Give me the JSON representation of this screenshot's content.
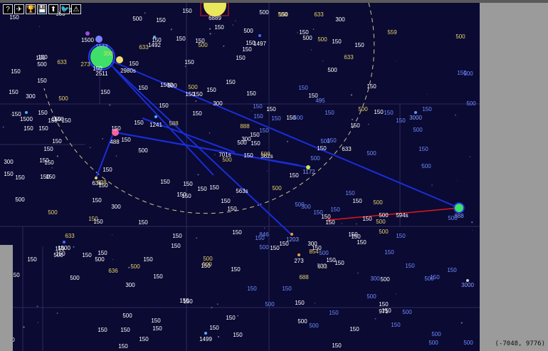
{
  "toolbar": {
    "buttons": [
      {
        "glyph": "?",
        "icon": "help-icon"
      },
      {
        "glyph": "✈",
        "icon": "send-icon"
      },
      {
        "glyph": "🏆",
        "icon": "trophy-icon"
      },
      {
        "glyph": "💾",
        "icon": "save-icon"
      },
      {
        "glyph": "⬆",
        "icon": "upload-icon"
      },
      {
        "glyph": "🐦",
        "icon": "twitter-icon"
      },
      {
        "glyph": "⚠",
        "icon": "warning-icon"
      }
    ]
  },
  "coords": "(-7048, 9776)",
  "colors": {
    "space": "#0b0a33",
    "own": "#ffffff",
    "enemy": "#5a8aff",
    "neutral": "#e8d468",
    "link": "#1a2dd8",
    "attack": "#e01818"
  },
  "planets": [
    {
      "id": "p1",
      "label": "6889",
      "color": "#e8e85a",
      "r": 16,
      "owner": "own"
    },
    {
      "id": "p2",
      "label": "2511",
      "color": "#3ee06a",
      "r": 16,
      "owner": "own"
    },
    {
      "id": "p3",
      "label": "1143",
      "color": "#8080ff",
      "r": 5,
      "owner": "own"
    },
    {
      "id": "p4",
      "label": "1500",
      "color": "#9b4dd8",
      "r": 3,
      "owner": "own"
    },
    {
      "id": "p5",
      "label": "1492",
      "color": "#4fb0ff",
      "r": 2,
      "owner": "own"
    },
    {
      "id": "p6",
      "label": "1497",
      "color": "#4a6cff",
      "r": 2,
      "owner": "own"
    },
    {
      "id": "p7",
      "label": "1500",
      "color": "#4fb0ff",
      "r": 2,
      "owner": "own"
    },
    {
      "id": "p8",
      "label": "1241",
      "color": "#4fb0ff",
      "r": 2,
      "owner": "own"
    },
    {
      "id": "p9",
      "label": "488",
      "color": "#ff5f9f",
      "r": 5,
      "owner": "own"
    },
    {
      "id": "p10",
      "label": "636",
      "color": "#e8d468",
      "r": 2,
      "owner": "own"
    },
    {
      "id": "p11",
      "label": "1172",
      "color": "#c6e65a",
      "r": 3,
      "owner": "own"
    },
    {
      "id": "p12",
      "label": "888",
      "color": "#3ee06a",
      "r": 6,
      "owner": "own"
    },
    {
      "id": "p13",
      "label": "1203",
      "color": "#e8a040",
      "r": 2,
      "owner": "own"
    },
    {
      "id": "p14",
      "label": "273",
      "color": "#e8a040",
      "r": 2,
      "owner": "own"
    },
    {
      "id": "p15",
      "label": "1500",
      "color": "#4a6cff",
      "r": 2,
      "owner": "own"
    },
    {
      "id": "p16",
      "label": "1499",
      "color": "#4fb0ff",
      "r": 2,
      "owner": "own"
    },
    {
      "id": "p17",
      "label": "3000",
      "color": "#5a9aff",
      "r": 2,
      "owner": "enemy"
    },
    {
      "id": "p18",
      "label": "3000",
      "color": "#cfcfcf",
      "r": 2,
      "owner": "enemy"
    },
    {
      "id": "p19",
      "label": "971",
      "color": "#cfcfcf",
      "r": 1,
      "owner": "own"
    },
    {
      "id": "p20",
      "label": "150",
      "color": "#e01818",
      "r": 2,
      "owner": "own"
    }
  ],
  "transfers": [
    {
      "id": "v1",
      "label": "2980s"
    },
    {
      "id": "v2",
      "label": "701s"
    },
    {
      "id": "v3",
      "label": "362s"
    },
    {
      "id": "v4",
      "label": "563s"
    },
    {
      "id": "v5",
      "label": "594s"
    }
  ],
  "labels_white": [
    "500",
    "500",
    "500",
    "500",
    "500",
    "150",
    "500",
    "150",
    "150",
    "500",
    "150",
    "150",
    "150",
    "1500",
    "150",
    "500",
    "300",
    "300",
    "150",
    "150",
    "150",
    "150",
    "150",
    "150",
    "150",
    "150",
    "150",
    "150",
    "150",
    "150",
    "150",
    "300",
    "150",
    "500",
    "150",
    "150",
    "150",
    "150",
    "150",
    "300",
    "150",
    "150",
    "500",
    "150",
    "150",
    "150",
    "150",
    "150",
    "150",
    "150",
    "150",
    "150",
    "150",
    "150",
    "150",
    "150",
    "150",
    "150",
    "150",
    "150",
    "150",
    "150",
    "150",
    "150",
    "150",
    "150",
    "150",
    "150",
    "500",
    "150",
    "150",
    "150",
    "150",
    "150",
    "150",
    "300",
    "150",
    "150",
    "150",
    "150",
    "150",
    "150",
    "150",
    "300",
    "150",
    "150",
    "150",
    "150",
    "150",
    "150",
    "150",
    "150",
    "500",
    "300",
    "150",
    "150",
    "150",
    "150",
    "300",
    "150",
    "150",
    "150",
    "150",
    "150",
    "500",
    "500",
    "150",
    "150",
    "150",
    "633",
    "150",
    "500",
    "150",
    "150",
    "150",
    "150",
    "150",
    "150",
    "150",
    "150",
    "150",
    "150",
    "150",
    "500",
    "150",
    "500",
    "150",
    "150",
    "150",
    "150",
    "150",
    "150",
    "150",
    "500",
    "150",
    "150",
    "150",
    "150",
    "150",
    "150",
    "150",
    "150",
    "150",
    "150"
  ],
  "labels_blue": [
    "500",
    "150",
    "500",
    "150",
    "500",
    "500",
    "500",
    "500",
    "500",
    "500",
    "500",
    "150",
    "150",
    "150",
    "500",
    "150",
    "150",
    "500",
    "500",
    "150",
    "300",
    "495",
    "150",
    "150",
    "846",
    "150",
    "150",
    "500",
    "150",
    "150",
    "500",
    "500",
    "150",
    "150",
    "150",
    "500",
    "500",
    "300",
    "150",
    "150",
    "150",
    "500",
    "500",
    "500",
    "150",
    "150",
    "150",
    "150",
    "150",
    "500"
  ],
  "labels_yellow": [
    "500",
    "500",
    "500",
    "633",
    "633",
    "633",
    "638",
    "500",
    "500",
    "500",
    "500",
    "633",
    "633",
    "500",
    "500",
    "636",
    "588",
    "854",
    "300",
    "500",
    "559",
    "500",
    "500",
    "500",
    "273",
    "888",
    "500",
    "500",
    "500",
    "500",
    "688",
    "633",
    "150"
  ]
}
